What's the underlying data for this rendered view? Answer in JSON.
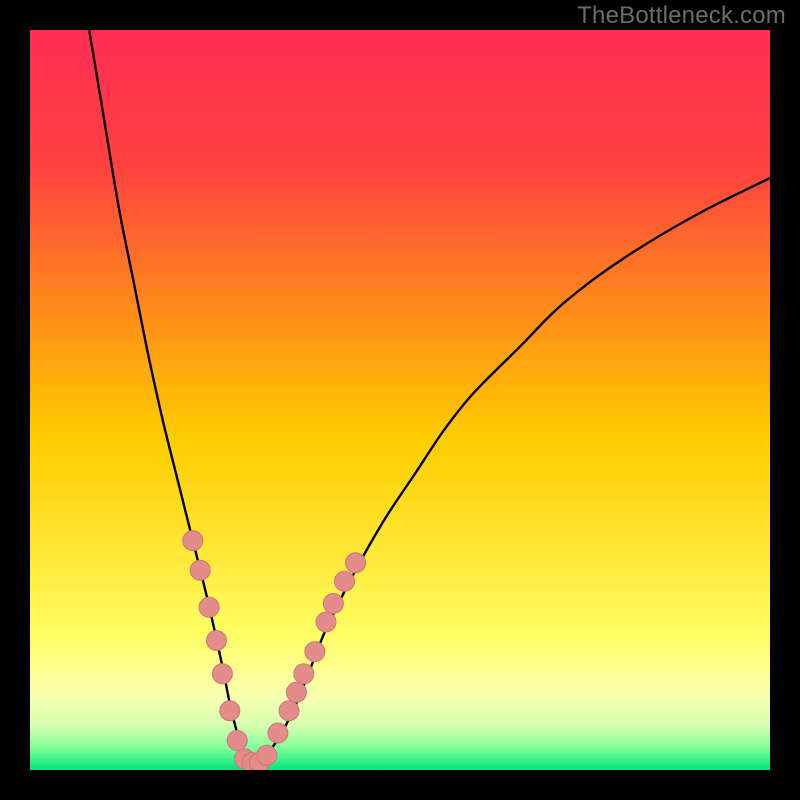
{
  "watermark": "TheBottleneck.com",
  "colors": {
    "background": "#000000",
    "gradient_stops": [
      {
        "offset": 0.0,
        "color": "#ff2d55"
      },
      {
        "offset": 0.18,
        "color": "#ff4040"
      },
      {
        "offset": 0.38,
        "color": "#ff8c1a"
      },
      {
        "offset": 0.55,
        "color": "#ffcc00"
      },
      {
        "offset": 0.7,
        "color": "#ffe633"
      },
      {
        "offset": 0.82,
        "color": "#ffff66"
      },
      {
        "offset": 0.9,
        "color": "#faffb0"
      },
      {
        "offset": 0.94,
        "color": "#d6ffb0"
      },
      {
        "offset": 0.97,
        "color": "#80ff99"
      },
      {
        "offset": 1.0,
        "color": "#00e67a"
      }
    ],
    "curve": "#000000",
    "marker_fill": "#e48b8b",
    "marker_stroke": "#cc7777"
  },
  "chart_data": {
    "type": "line",
    "title": "",
    "xlabel": "",
    "ylabel": "",
    "xlim": [
      0,
      100
    ],
    "ylim": [
      0,
      100
    ],
    "series": [
      {
        "name": "bottleneck-curve",
        "x": [
          8,
          10,
          12,
          14,
          16,
          18,
          20,
          22,
          24,
          26,
          27,
          28,
          29,
          30,
          31,
          32,
          34,
          36,
          38,
          40,
          44,
          48,
          52,
          56,
          60,
          66,
          72,
          80,
          90,
          100
        ],
        "y": [
          100,
          88,
          76,
          66,
          56,
          47,
          39,
          31,
          23,
          14,
          9,
          5,
          2,
          1,
          1,
          2,
          5,
          9,
          14,
          19,
          27,
          34,
          40,
          46,
          51,
          57,
          63,
          69,
          75,
          80
        ]
      }
    ],
    "markers": [
      {
        "x": 22.0,
        "y": 31.0
      },
      {
        "x": 23.0,
        "y": 27.0
      },
      {
        "x": 24.2,
        "y": 22.0
      },
      {
        "x": 25.2,
        "y": 17.5
      },
      {
        "x": 26.0,
        "y": 13.0
      },
      {
        "x": 27.0,
        "y": 8.0
      },
      {
        "x": 28.0,
        "y": 4.0
      },
      {
        "x": 29.0,
        "y": 1.5
      },
      {
        "x": 30.0,
        "y": 1.0
      },
      {
        "x": 31.0,
        "y": 1.0
      },
      {
        "x": 32.0,
        "y": 2.0
      },
      {
        "x": 33.5,
        "y": 5.0
      },
      {
        "x": 35.0,
        "y": 8.0
      },
      {
        "x": 36.0,
        "y": 10.5
      },
      {
        "x": 37.0,
        "y": 13.0
      },
      {
        "x": 38.5,
        "y": 16.0
      },
      {
        "x": 40.0,
        "y": 20.0
      },
      {
        "x": 41.0,
        "y": 22.5
      },
      {
        "x": 42.5,
        "y": 25.5
      },
      {
        "x": 44.0,
        "y": 28.0
      }
    ]
  }
}
